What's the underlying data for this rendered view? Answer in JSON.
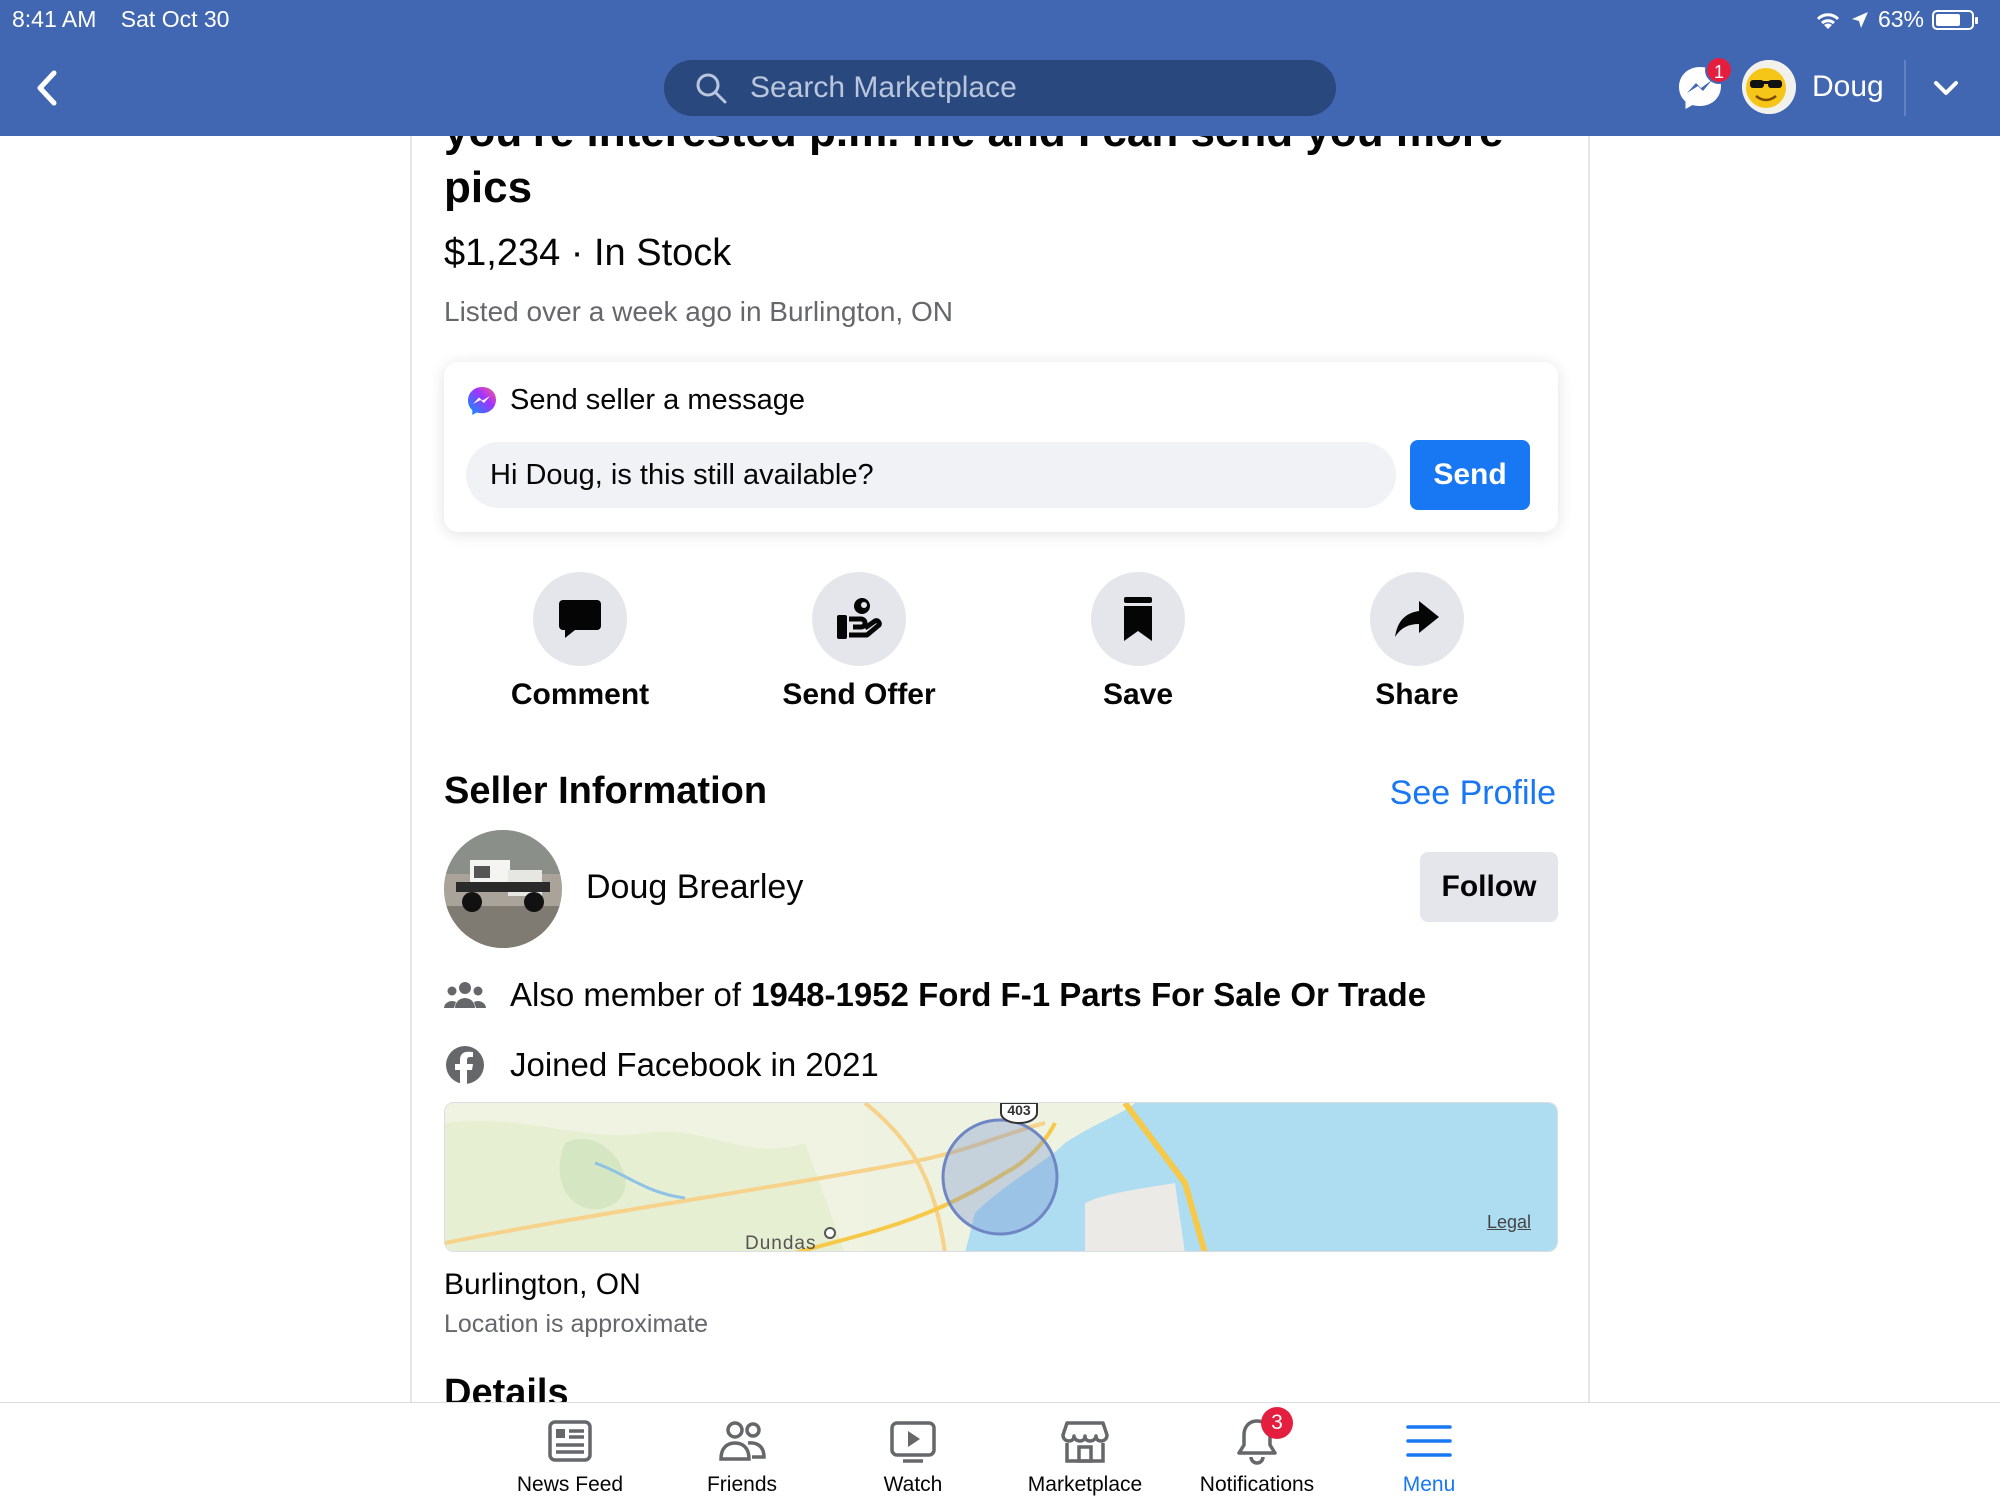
{
  "status_bar": {
    "time": "8:41 AM",
    "date": "Sat Oct 30",
    "battery": "63%"
  },
  "header": {
    "search_placeholder": "Search Marketplace",
    "messenger_badge": "1",
    "user_name": "Doug"
  },
  "listing": {
    "title": "you're interested p.m. me and I can send you more pics",
    "price_stock": "$1,234 · In Stock",
    "listed": "Listed over a week ago in Burlington, ON"
  },
  "message_card": {
    "heading": "Send seller a message",
    "input_value": "Hi Doug, is this still available?",
    "send_label": "Send"
  },
  "actions": [
    {
      "label": "Comment",
      "icon": "comment-icon"
    },
    {
      "label": "Send Offer",
      "icon": "offer-icon"
    },
    {
      "label": "Save",
      "icon": "bookmark-icon"
    },
    {
      "label": "Share",
      "icon": "share-icon"
    }
  ],
  "seller": {
    "section_title": "Seller Information",
    "see_profile": "See Profile",
    "name": "Doug Brearley",
    "follow_label": "Follow",
    "member_prefix": "Also member of",
    "member_group": "1948-1952 Ford F-1 Parts For Sale Or Trade",
    "joined": "Joined Facebook in 2021"
  },
  "map": {
    "town_label": "Dundas",
    "road_label": "403",
    "legal": "Legal"
  },
  "location": {
    "title": "Burlington, ON",
    "subtitle": "Location is approximate"
  },
  "details_heading": "Details",
  "bottom_nav": [
    {
      "label": "News Feed",
      "icon": "news-feed-icon"
    },
    {
      "label": "Friends",
      "icon": "friends-icon"
    },
    {
      "label": "Watch",
      "icon": "watch-icon"
    },
    {
      "label": "Marketplace",
      "icon": "marketplace-icon"
    },
    {
      "label": "Notifications",
      "icon": "bell-icon",
      "badge": "3"
    },
    {
      "label": "Menu",
      "icon": "menu-icon",
      "active": true
    }
  ],
  "colors": {
    "header": "#4267b2",
    "accent": "#1877f2",
    "badge": "#e41e3f"
  }
}
